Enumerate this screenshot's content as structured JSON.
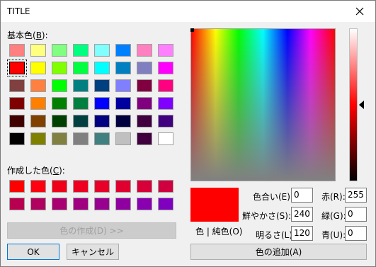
{
  "window": {
    "title": "TITLE"
  },
  "basic": {
    "label": "基本色(",
    "label_key": "B",
    "label_end": "):",
    "colors": [
      [
        "#ff8080",
        "#ffff80",
        "#80ff80",
        "#00ff80",
        "#80ffff",
        "#0080ff",
        "#ff80c0",
        "#ff80ff"
      ],
      [
        "#ff0000",
        "#ffff00",
        "#80ff00",
        "#00ff40",
        "#00ffff",
        "#0080c0",
        "#8080c0",
        "#ff00ff"
      ],
      [
        "#804040",
        "#ff8040",
        "#00ff00",
        "#008080",
        "#004080",
        "#8080ff",
        "#800040",
        "#ff0080"
      ],
      [
        "#800000",
        "#ff8000",
        "#008000",
        "#008040",
        "#0000ff",
        "#0000a0",
        "#800080",
        "#8000ff"
      ],
      [
        "#400000",
        "#804000",
        "#004000",
        "#004040",
        "#000080",
        "#000040",
        "#400040",
        "#400080"
      ],
      [
        "#000000",
        "#808000",
        "#808040",
        "#808080",
        "#408080",
        "#c0c0c0",
        "#400040",
        "#ffffff"
      ]
    ]
  },
  "custom": {
    "label": "作成した色(",
    "label_key": "C",
    "label_end": "):",
    "colors": [
      [
        "#ff0000",
        "#ff0010",
        "#f00018",
        "#ee0020",
        "#e80028",
        "#e00030",
        "#d80038",
        "#d00040"
      ],
      [
        "#b80050",
        "#b00060",
        "#a80070",
        "#a00080",
        "#980090",
        "#9000a0",
        "#8800b0",
        "#8000c0"
      ]
    ]
  },
  "buttons": {
    "define_custom": "色の作成(D) >>",
    "ok": "OK",
    "cancel": "キャンセル",
    "add_custom": "色の追加(A)"
  },
  "preview": {
    "label": "色 | 純色(O)",
    "color": "#ff0000"
  },
  "fields": {
    "hue": {
      "label": "色合い(E):",
      "value": "0"
    },
    "sat": {
      "label": "鮮やかさ(S):",
      "value": "240"
    },
    "lum": {
      "label": "明るさ(L):",
      "value": "120"
    },
    "red": {
      "label": "赤(R):",
      "value": "255"
    },
    "green": {
      "label": "緑(G):",
      "value": "0"
    },
    "blue": {
      "label": "青(U):",
      "value": "0"
    }
  },
  "selected_basic": [
    1,
    0
  ],
  "luminance_level": 0.5
}
